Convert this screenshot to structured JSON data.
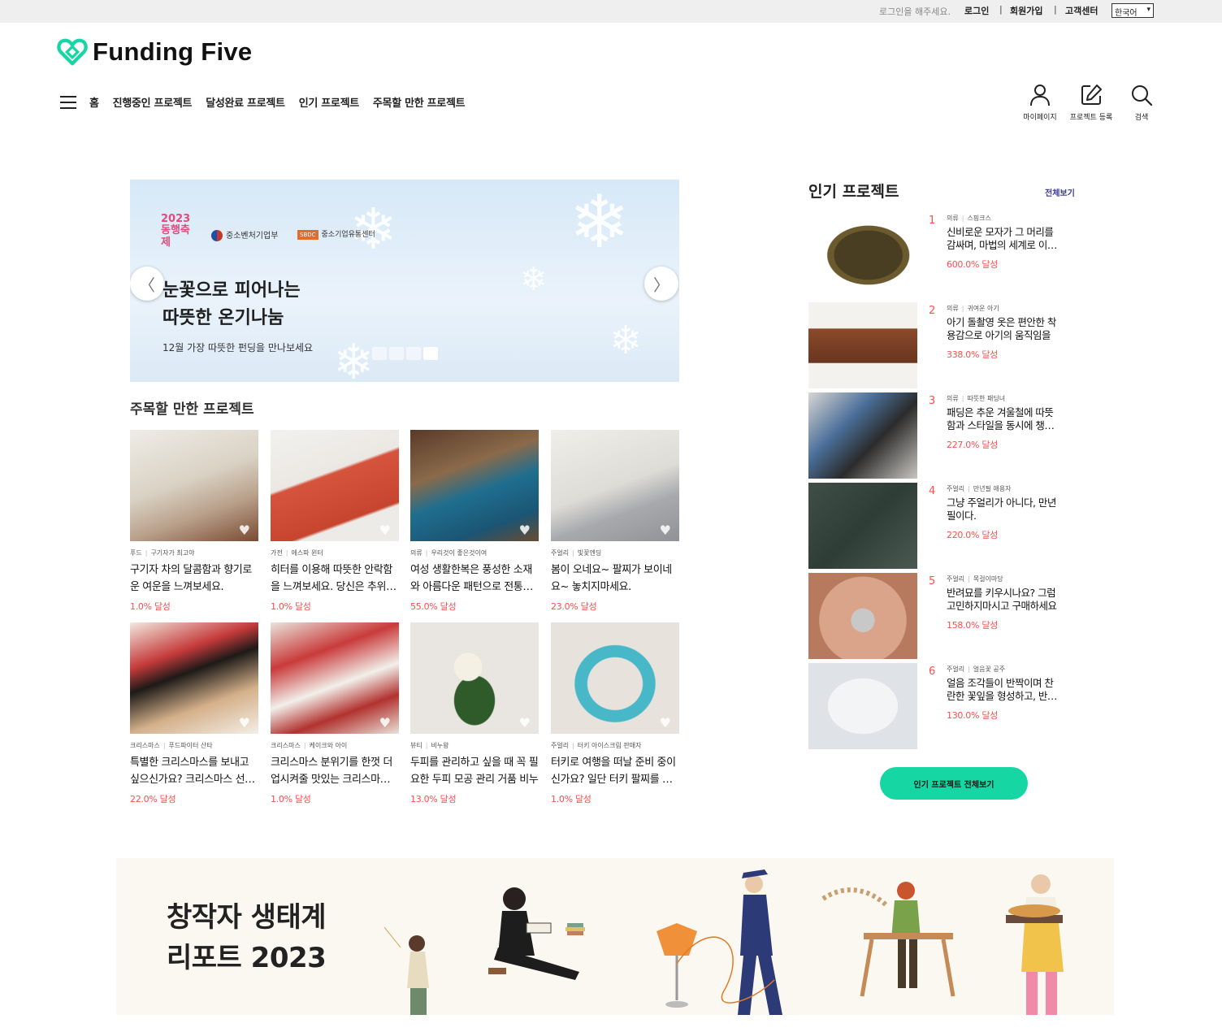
{
  "topbar": {
    "login_msg": "로그인을 해주세요.",
    "links": [
      "로그인",
      "회원가입",
      "고객센터"
    ],
    "separator": "|",
    "language": "한국어"
  },
  "brand": {
    "name": "Funding Five",
    "accent": "#16d6a4"
  },
  "nav": {
    "items": [
      "홈",
      "진행중인 프로젝트",
      "달성완료 프로젝트",
      "인기 프로젝트",
      "주목할 만한 프로젝트"
    ]
  },
  "actions": [
    {
      "label": "마이페이지",
      "icon": "user-icon"
    },
    {
      "label": "프로젝트 등록",
      "icon": "edit-icon"
    },
    {
      "label": "검색",
      "icon": "search-icon"
    }
  ],
  "banner": {
    "badge": "2023 동행축제",
    "org1": "중소벤처기업부",
    "org2_box": "SBDC",
    "org2": "중소기업유통센터",
    "headline1": "눈꽃으로 피어나는",
    "headline2": "따뜻한 온기나눔",
    "sub": "12월 가장 따뜻한 펀딩을 만나보세요",
    "prev": "〈",
    "next": "〉"
  },
  "featured": {
    "title": "주목할 만한 프로젝트",
    "items": [
      {
        "category": "푸드",
        "creator": "구기자가 최고야",
        "title": "구기자 차의 달콤함과 향기로운 여운을 느껴보세요.",
        "rate": "1.0% 달성"
      },
      {
        "category": "가전",
        "creator": "에스파 윈터",
        "title": "히터를 이용해 따뜻한 안락함을 느껴보세요. 당신은 추위를 이기며 편안하게",
        "rate": "1.0% 달성"
      },
      {
        "category": "의류",
        "creator": "우리것이 좋은것이여",
        "title": "여성 생활한복은 풍성한 소재와 아름다운 패턴으로 전통미를",
        "rate": "55.0% 달성"
      },
      {
        "category": "주얼리",
        "creator": "빛꽃엔딩",
        "title": "봄이 오네요~ 팔찌가 보이네요~ 놓치지마세요.",
        "rate": "23.0% 달성"
      },
      {
        "category": "크리스마스",
        "creator": "푸드파이터 산타",
        "title": "특별한 크리스마스를 보내고 싶으신가요? 크리스마스 선물을",
        "rate": "22.0% 달성"
      },
      {
        "category": "크리스마스",
        "creator": "케이크와 아이",
        "title": "크리스마스 분위기를 한껏 더 업시켜줄 맛있는 크리스마스 케이크",
        "rate": "1.0% 달성"
      },
      {
        "category": "뷰티",
        "creator": "비누왕",
        "title": "두피를 관리하고 싶을 때 꼭 필요한 두피 모공 관리 거품 비누",
        "rate": "13.0% 달성"
      },
      {
        "category": "주얼리",
        "creator": "터키 아이스크림 판매자",
        "title": "터키로 여행을 떠날 준비 중이신가요? 일단 터키 팔찌를 하나",
        "rate": "1.0% 달성"
      }
    ]
  },
  "popular": {
    "title": "인기 프로젝트",
    "view_all": "전체보기",
    "button": "인기 프로젝트 전체보기",
    "items": [
      {
        "rank": "1",
        "category": "의류",
        "creator": "스핑크스",
        "title": "신비로운 모자가 그 머리를 감싸며, 마법의 세계로 이끄는",
        "rate": "600.0% 달성"
      },
      {
        "rank": "2",
        "category": "의류",
        "creator": "귀여운 아기",
        "title": "아기 돌촬영 옷은 편안한 착용감으로 아기의 움직임을",
        "rate": "338.0% 달성"
      },
      {
        "rank": "3",
        "category": "의류",
        "creator": "따뜻한 패딩녀",
        "title": "패딩은 추운 겨울철에 따뜻함과 스타일을 동시에 챙겨줍니다",
        "rate": "227.0% 달성"
      },
      {
        "rank": "4",
        "category": "주얼리",
        "creator": "만년필 애용자",
        "title": "그냥 주얼리가 아니다, 만년필이다.",
        "rate": "220.0% 달성"
      },
      {
        "rank": "5",
        "category": "주얼리",
        "creator": "목걸이마당",
        "title": "반려묘를 키우시나요? 그럼 고민하지마시고 구매하세요",
        "rate": "158.0% 달성"
      },
      {
        "rank": "6",
        "category": "주얼리",
        "creator": "얼음꽃 공주",
        "title": "얼음 조각들이 반짝이며 찬란한 꽃잎을 형성하고, 반지에",
        "rate": "130.0% 달성"
      }
    ]
  },
  "report": {
    "line1": "창작자 생태계",
    "line2": "리포트 2023"
  }
}
